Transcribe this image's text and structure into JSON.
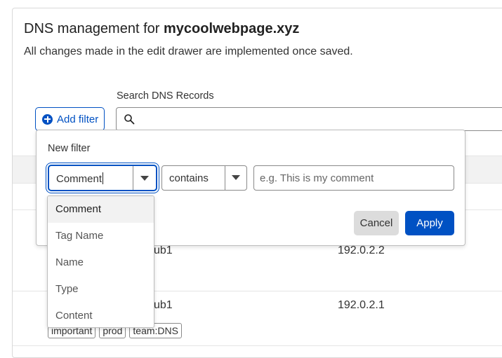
{
  "header": {
    "title_prefix": "DNS management for ",
    "domain": "mycoolwebpage.xyz",
    "subtitle": "All changes made in the edit drawer are implemented once saved."
  },
  "search": {
    "label": "Search DNS Records",
    "icon": "search-icon"
  },
  "toolbar": {
    "add_filter_label": "Add filter"
  },
  "filter_popover": {
    "title": "New filter",
    "field_value": "Comment",
    "operator_value": "contains",
    "value_placeholder": "e.g. This is my comment",
    "cancel_label": "Cancel",
    "apply_label": "Apply"
  },
  "field_options": [
    "Comment",
    "Tag Name",
    "Name",
    "Type",
    "Content"
  ],
  "table": {
    "rows": [
      {
        "name_partial": "ub1",
        "content": "192.0.2.2"
      },
      {
        "name_partial": "ub1",
        "content": "192.0.2.1",
        "tags": [
          "important",
          "prod",
          "team:DNS"
        ]
      }
    ]
  },
  "colors": {
    "accent": "#0051c3",
    "border": "#8a8a8a",
    "muted_bg": "#f2f2f2"
  }
}
